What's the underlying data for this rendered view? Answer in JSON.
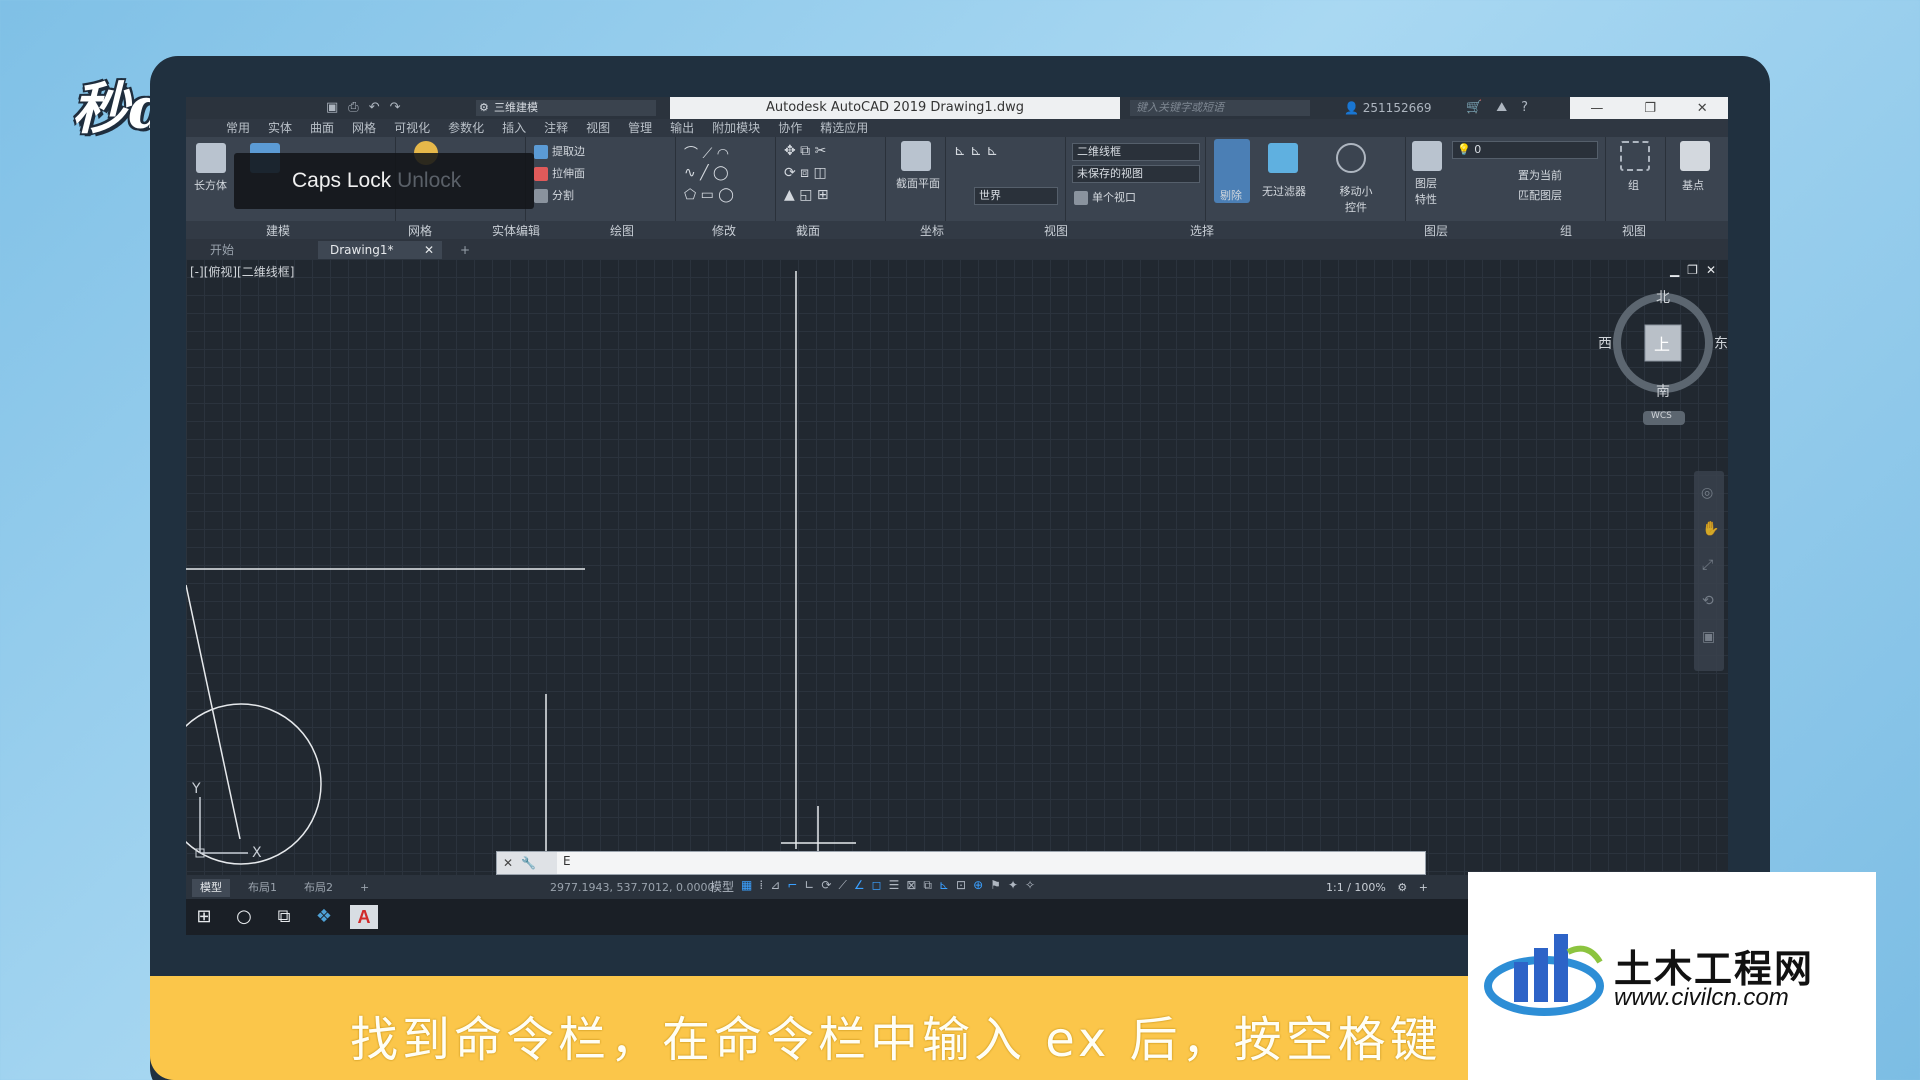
{
  "brand_logo": "秒dong视频",
  "titlebar": {
    "workspace": "三维建模",
    "title": "Autodesk AutoCAD 2019    Drawing1.dwg",
    "search_placeholder": "键入关键字或短语",
    "user_id": "251152669"
  },
  "ribbon_tabs": [
    "常用",
    "实体",
    "曲面",
    "网格",
    "可视化",
    "参数化",
    "插入",
    "注释",
    "视图",
    "管理",
    "输出",
    "附加模块",
    "协作",
    "精选应用"
  ],
  "ribbon": {
    "box_label": "长方体",
    "extract_edges": "提取边",
    "extrude_face": "拉伸面",
    "separate": "分割",
    "section_plane": "截面平面",
    "visual_style": "二维线框",
    "unsaved_view": "未保存的视图",
    "world": "世界",
    "single_viewport": "单个视口",
    "cull": "剔除",
    "no_filter": "无过滤器",
    "move_gizmo": "移动小控件",
    "layer_props": "图层特性",
    "layer_value": "0",
    "set_current": "置为当前",
    "match_layer": "匹配图层",
    "group": "组",
    "base_point": "基点"
  },
  "ribbon_panels": [
    "建模",
    "网格",
    "实体编辑",
    "绘图",
    "修改",
    "截面",
    "坐标",
    "视图",
    "选择",
    "图层",
    "组",
    "视图"
  ],
  "caps_lock": {
    "label": "Caps Lock",
    "state": "Unlock"
  },
  "doc_tabs": [
    "开始",
    "Drawing1*"
  ],
  "viewport": {
    "label": "[-][俯视][二维线框]",
    "compass": {
      "north": "北",
      "south": "南",
      "east": "东",
      "west": "西",
      "top": "上",
      "wcs": "WCS"
    },
    "ucs_x": "X",
    "ucs_y": "Y"
  },
  "command_line": {
    "value": "E"
  },
  "layout_tabs": [
    "模型",
    "布局1",
    "布局2"
  ],
  "status_bar": {
    "coordinates": "2977.1943, 537.7012, 0.0000",
    "model": "模型",
    "scale": "1:1 / 100%"
  },
  "subtitle": "找到命令栏，在命令栏中输入 ex 后，按空格键",
  "watermark": {
    "title": "土木工程网",
    "url": "www.civilcn.com"
  },
  "colors": {
    "accent_blue": "#3aa0ff",
    "subtitle_bg": "#fbc64a",
    "viewport_bg": "#212830"
  }
}
